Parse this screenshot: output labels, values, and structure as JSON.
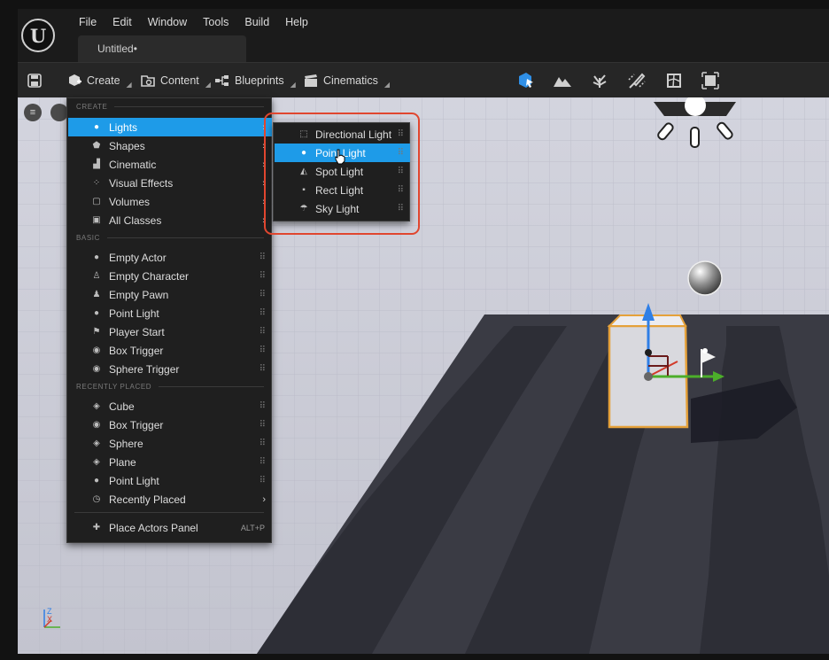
{
  "app": {
    "menu": [
      "File",
      "Edit",
      "Window",
      "Tools",
      "Build",
      "Help"
    ],
    "tab_title": "Untitled•"
  },
  "toolbar": {
    "create_label": "Create",
    "content_label": "Content",
    "blueprints_label": "Blueprints",
    "cinematics_label": "Cinematics"
  },
  "create_menu": {
    "section_create": "CREATE",
    "create_items": [
      {
        "label": "Lights",
        "icon": "bulb-icon"
      },
      {
        "label": "Shapes",
        "icon": "shapes-icon"
      },
      {
        "label": "Cinematic",
        "icon": "clapper-icon"
      },
      {
        "label": "Visual Effects",
        "icon": "sparkle-icon"
      },
      {
        "label": "Volumes",
        "icon": "volume-icon"
      },
      {
        "label": "All Classes",
        "icon": "classes-icon"
      }
    ],
    "section_basic": "BASIC",
    "basic_items": [
      {
        "label": "Empty Actor",
        "icon": "actor-icon"
      },
      {
        "label": "Empty Character",
        "icon": "character-icon"
      },
      {
        "label": "Empty Pawn",
        "icon": "pawn-icon"
      },
      {
        "label": "Point Light",
        "icon": "bulb-icon"
      },
      {
        "label": "Player Start",
        "icon": "flag-icon"
      },
      {
        "label": "Box Trigger",
        "icon": "trigger-icon"
      },
      {
        "label": "Sphere Trigger",
        "icon": "trigger-icon"
      }
    ],
    "section_recent": "RECENTLY PLACED",
    "recent_items": [
      {
        "label": "Cube",
        "icon": "cube-icon"
      },
      {
        "label": "Box Trigger",
        "icon": "trigger-icon"
      },
      {
        "label": "Sphere",
        "icon": "sphere-icon"
      },
      {
        "label": "Plane",
        "icon": "plane-icon"
      },
      {
        "label": "Point Light",
        "icon": "bulb-icon"
      },
      {
        "label": "Recently Placed",
        "icon": "clock-icon"
      }
    ],
    "place_actors_label": "Place Actors Panel",
    "place_actors_shortcut": "ALT+P"
  },
  "lights_submenu": [
    {
      "label": "Directional Light",
      "icon": "directional-light-icon"
    },
    {
      "label": "Point Light",
      "icon": "bulb-icon",
      "selected": true
    },
    {
      "label": "Spot Light",
      "icon": "spot-light-icon"
    },
    {
      "label": "Rect Light",
      "icon": "rect-light-icon"
    },
    {
      "label": "Sky Light",
      "icon": "sky-light-icon"
    }
  ],
  "colors": {
    "accent": "#1e9be8",
    "highlight_box": "#e0462f",
    "gizmo_z": "#2f7fe6",
    "gizmo_y": "#4cae2a",
    "gizmo_x": "#d23a2a",
    "selection_outline": "#e5a13a"
  }
}
